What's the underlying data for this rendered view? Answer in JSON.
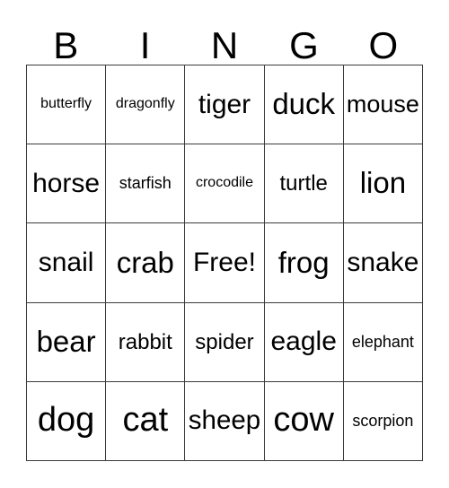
{
  "card": {
    "title": "BINGO",
    "header_letters": [
      "B",
      "I",
      "N",
      "G",
      "O"
    ],
    "colors": {
      "grid_line": "#3a3a3a",
      "text": "#000000",
      "background": "#ffffff"
    },
    "free_space_label": "Free!",
    "rows": [
      [
        {
          "label": "butterfly"
        },
        {
          "label": "dragonfly"
        },
        {
          "label": "tiger"
        },
        {
          "label": "duck"
        },
        {
          "label": "mouse"
        }
      ],
      [
        {
          "label": "horse"
        },
        {
          "label": "starfish"
        },
        {
          "label": "crocodile"
        },
        {
          "label": "turtle"
        },
        {
          "label": "lion"
        }
      ],
      [
        {
          "label": "snail"
        },
        {
          "label": "crab"
        },
        {
          "label": "Free!"
        },
        {
          "label": "frog"
        },
        {
          "label": "snake"
        }
      ],
      [
        {
          "label": "bear"
        },
        {
          "label": "rabbit"
        },
        {
          "label": "spider"
        },
        {
          "label": "eagle"
        },
        {
          "label": "elephant"
        }
      ],
      [
        {
          "label": "dog"
        },
        {
          "label": "cat"
        },
        {
          "label": "sheep"
        },
        {
          "label": "cow"
        },
        {
          "label": "scorpion"
        }
      ]
    ]
  }
}
